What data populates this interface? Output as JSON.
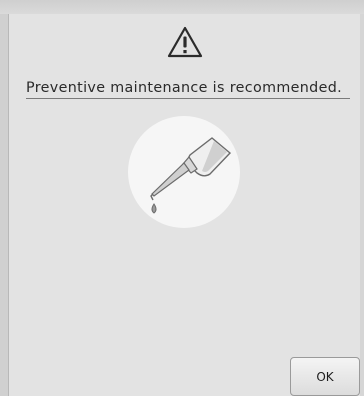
{
  "dialog": {
    "icon": "warning-icon",
    "message": "Preventive maintenance is recommended.",
    "illustration": "oil-bottle-icon",
    "ok_label": "OK"
  }
}
